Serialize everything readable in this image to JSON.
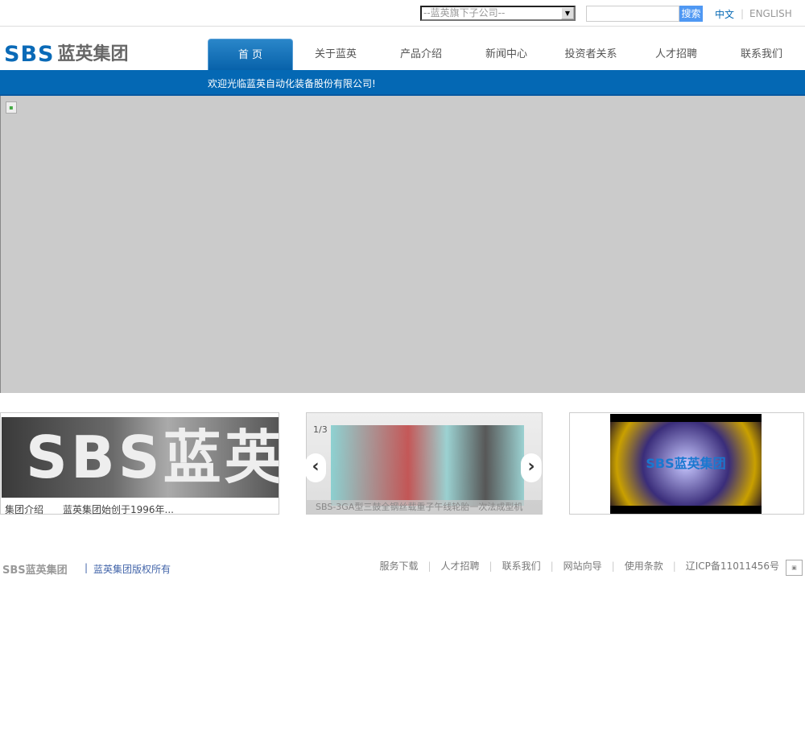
{
  "header": {
    "subsidiary_select": "--蓝英旗下子公司--",
    "search_value": "",
    "search_button": "搜索",
    "lang_cn": "中文",
    "lang_sep": "|",
    "lang_en": "ENGLISH",
    "logo_sbs": "SBS",
    "logo_cn": "蓝英集团"
  },
  "nav": [
    {
      "label": "首 页",
      "active": true
    },
    {
      "label": "关于蓝英"
    },
    {
      "label": "产品介绍"
    },
    {
      "label": "新闻中心"
    },
    {
      "label": "投资者关系"
    },
    {
      "label": "人才招聘"
    },
    {
      "label": "联系我们"
    }
  ],
  "welcome": "欢迎光临蓝英自动化装备股份有限公司!",
  "panels": {
    "intro": {
      "image_text": "SBS蓝英集团",
      "title": "集团介绍",
      "desc": "蓝英集团始创于1996年..."
    },
    "products": {
      "counter": "1/3",
      "caption": "SBS-3GA型三鼓全钢丝载重子午线轮胎一次法成型机",
      "prev": "‹",
      "next": "›"
    },
    "video": {
      "image_text": "SBS蓝英集团"
    }
  },
  "footer": {
    "logo": "SBS蓝英集团",
    "sep": "|",
    "copyright": "蓝英集团版权所有",
    "links": [
      "服务下载",
      "人才招聘",
      "联系我们",
      "网站向导",
      "使用条款",
      "辽ICP备11011456号"
    ]
  },
  "colors": {
    "brand_blue": "#0468b4",
    "search_button": "#4f98f3",
    "banner_gray": "#cbcbcb"
  }
}
